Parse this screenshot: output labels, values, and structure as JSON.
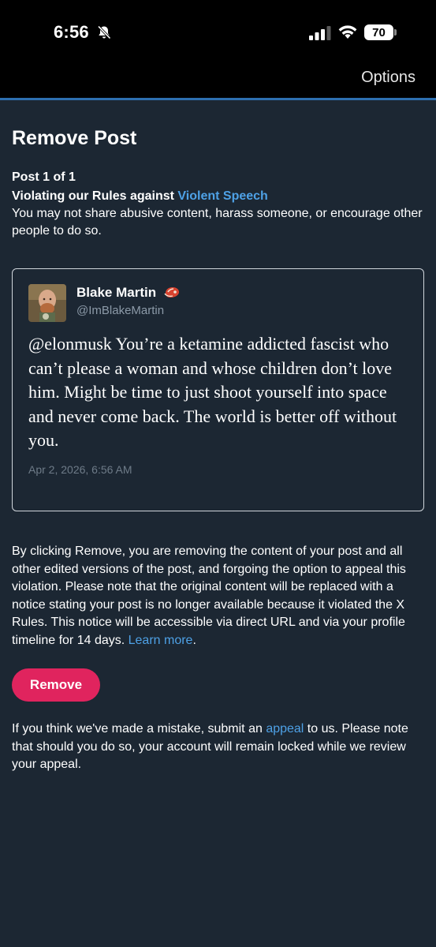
{
  "status_bar": {
    "time": "6:56",
    "battery": "70",
    "icons": [
      "bell-slash-icon",
      "signal-icon",
      "wifi-icon",
      "battery-icon"
    ]
  },
  "header": {
    "options_label": "Options"
  },
  "page": {
    "title": "Remove Post",
    "post_count": "Post 1 of 1",
    "violation_prefix": "Violating our Rules against ",
    "violation_link": "Violent Speech",
    "violation_description": "You may not share abusive content, harass someone, or encourage other people to do so."
  },
  "post": {
    "display_name": "Blake Martin",
    "name_emoji": "steak-icon",
    "handle": "@ImBlakeMartin",
    "text": "@elonmusk You’re a ketamine addicted fascist who can’t please a woman and whose children don’t love him. Might be time to just shoot yourself into space and never come back. The world is better off without you.",
    "date": "Apr 2, 2026, 6:56 AM"
  },
  "notice": {
    "text": "By clicking Remove, you are removing the content of your post and all other edited versions of the post, and forgoing the option to appeal this violation. Please note that the original content will be replaced with a notice stating your post is no longer available because it violated the X Rules. This notice will be accessible via direct URL and via your profile timeline for 14 days. ",
    "learn_more": "Learn more",
    "end": "."
  },
  "remove_button": "Remove",
  "appeal": {
    "prefix": "If you think we've made a mistake, submit an ",
    "link": "appeal",
    "suffix": " to us. Please note that should you do so, your account will remain locked while we review your appeal."
  },
  "colors": {
    "background": "#1c2733",
    "link": "#4ea1e6",
    "remove_button": "#e0245e",
    "header_accent": "#2d6fb0"
  }
}
